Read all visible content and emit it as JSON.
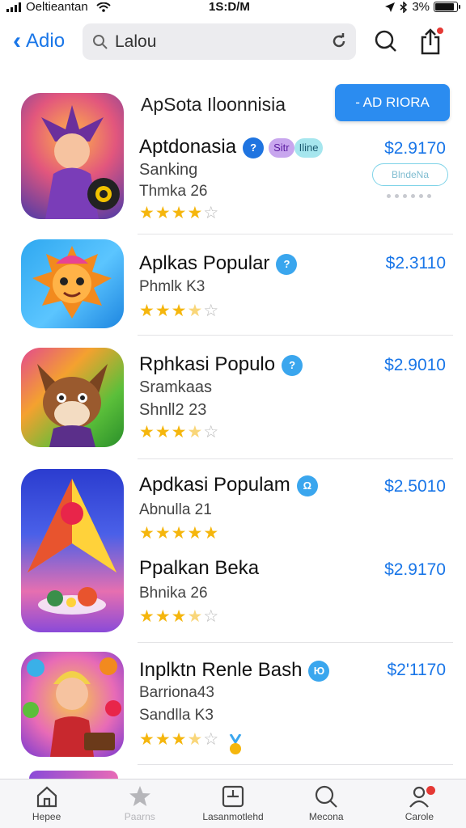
{
  "status_bar": {
    "carrier": "Oeltieantan",
    "time": "1S:D/M",
    "battery": "3%",
    "battery_level": 0.9
  },
  "nav": {
    "back_label": "Adio",
    "search_value": "Lalou",
    "icons": [
      "chevron-left-icon",
      "search-icon",
      "refresh-icon",
      "share-icon"
    ]
  },
  "section": {
    "heading": "ApSota Iloonnisia",
    "get_label": "- AD RIORA",
    "outline_label": "BlndeNa"
  },
  "apps": [
    {
      "name": "Aptdonasia",
      "badge": "?",
      "pill1": "Sitr",
      "pill2": "Iline",
      "sub1": "Sanking",
      "sub2": "Thmka 26",
      "price": "$2.9170",
      "rating": 4
    },
    {
      "name": "Aplkas Popular",
      "badge": "?",
      "sub1": "Phmlk K3",
      "price": "$2.3110",
      "rating": 3.5
    },
    {
      "name": "Rphkasi Populo",
      "badge": "?",
      "sub1": "Sramkaas",
      "sub2": "Shnll2 23",
      "price": "$2.9010",
      "rating": 3.5
    },
    {
      "name": "Apdkasi Populam",
      "badge": "Ω",
      "sub1": "Abnulla 21",
      "price": "$2.5010",
      "rating": 5
    },
    {
      "name": "Ppalkan Beka",
      "sub1": "Bhnika 26",
      "price": "$2.9170",
      "rating": 3.5
    },
    {
      "name": "Inplktn Renle Bash",
      "badge": "Ю",
      "sub1": "Barriona43",
      "sub2": "Sandlla K3",
      "price": "$2'1170",
      "rating": 3.5
    }
  ],
  "tabs": [
    {
      "label": "Hepee",
      "icon": "home-icon"
    },
    {
      "label": "Paarns",
      "icon": "star-icon"
    },
    {
      "label": "Lasanmotlehd",
      "icon": "apps-icon"
    },
    {
      "label": "Mecona",
      "icon": "search-icon"
    },
    {
      "label": "Carole",
      "icon": "profile-icon"
    }
  ],
  "colors": {
    "accent": "#1976e8",
    "button": "#2b8cf0",
    "badge": "#3aa6ee",
    "star": "#f5b60d",
    "notification": "#e53935"
  }
}
